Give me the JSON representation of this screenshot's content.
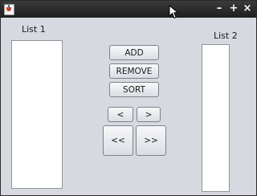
{
  "titlebar": {
    "minimize_glyph": "–",
    "maximize_glyph": "+",
    "close_glyph": "×"
  },
  "list1": {
    "label": "List 1",
    "items": []
  },
  "list2": {
    "label": "List 2",
    "items": []
  },
  "buttons": {
    "add": "ADD",
    "remove": "REMOVE",
    "sort": "SORT",
    "move_left": "<",
    "move_right": ">",
    "move_all_left": "<<",
    "move_all_right": ">>"
  }
}
